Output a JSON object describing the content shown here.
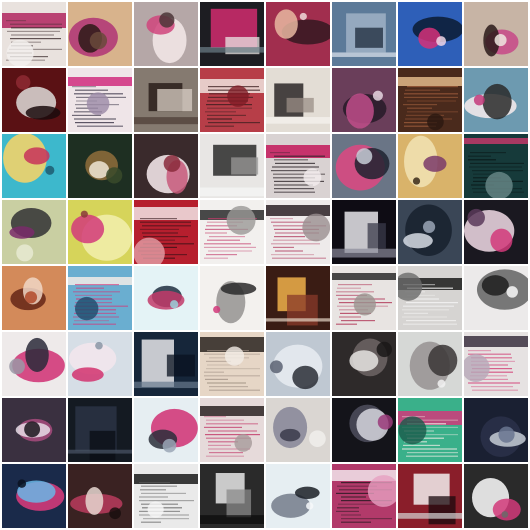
{
  "image": {
    "kind": "image-grid",
    "rows": 8,
    "cols": 8,
    "description_tags": [
      "generated-samples",
      "magazine-page-textures",
      "pink-magenta-accents"
    ]
  },
  "tiles": [
    {
      "bg": "#e9e2de",
      "a": "#b0265f",
      "b": "#3a2b2c",
      "c": "#f2f0ee",
      "style": "text"
    },
    {
      "bg": "#d8b38c",
      "a": "#2b1a16",
      "b": "#b23a77",
      "c": "#6a4a3b",
      "style": "blob"
    },
    {
      "bg": "#b5a7a7",
      "a": "#d0457c",
      "b": "#f1e6e6",
      "c": "#4b3537",
      "style": "blob"
    },
    {
      "bg": "#1d1d22",
      "a": "#d22b6e",
      "b": "#e9e6e4",
      "c": "#6c7f88",
      "style": "panel"
    },
    {
      "bg": "#a12e4e",
      "a": "#e7b7a1",
      "b": "#3a1a23",
      "c": "#f0d7d8",
      "style": "blob"
    },
    {
      "bg": "#5c7a99",
      "a": "#9fb2c6",
      "b": "#1d2b3b",
      "c": "#dfe6ee",
      "style": "panel"
    },
    {
      "bg": "#2e5fb8",
      "a": "#d53179",
      "b": "#0d1f3a",
      "c": "#f0d6e6",
      "style": "blob"
    },
    {
      "bg": "#c7b4a5",
      "a": "#2a1a19",
      "b": "#c64e8a",
      "c": "#efe7e0",
      "style": "blob"
    },
    {
      "bg": "#5a1114",
      "a": "#1b0c0d",
      "b": "#d6d0cd",
      "c": "#8e2a33",
      "style": "blob"
    },
    {
      "bg": "#efe5e8",
      "a": "#d02d7e",
      "b": "#2f2a3d",
      "c": "#9b8aa6",
      "style": "text"
    },
    {
      "bg": "#857a70",
      "a": "#2a1f1a",
      "b": "#d9cfc6",
      "c": "#4a3b33",
      "style": "panel"
    },
    {
      "bg": "#b73e48",
      "a": "#f0e4df",
      "b": "#3a1d1e",
      "c": "#7f1c25",
      "style": "text"
    },
    {
      "bg": "#e3ddd5",
      "a": "#2b2727",
      "b": "#9a8d85",
      "c": "#f6f3f0",
      "style": "panel"
    },
    {
      "bg": "#6a3e5a",
      "a": "#c04e8a",
      "b": "#2a1c2a",
      "c": "#e6d6e0",
      "style": "blob"
    },
    {
      "bg": "#4a2a1c",
      "a": "#e0b98a",
      "b": "#9a5a3a",
      "c": "#2a1810",
      "style": "text"
    },
    {
      "bg": "#6d9ab0",
      "a": "#2a2a2a",
      "b": "#f0e8ea",
      "c": "#c43a7b",
      "style": "blob"
    },
    {
      "bg": "#3db8cc",
      "a": "#c8325b",
      "b": "#f1d36a",
      "c": "#1d5a70",
      "style": "blob"
    },
    {
      "bg": "#1e2f22",
      "a": "#f0e6d6",
      "b": "#8a6a3a",
      "c": "#3a4a2a",
      "style": "blob"
    },
    {
      "bg": "#3a2a2c",
      "a": "#c85a7b",
      "b": "#efe2e6",
      "c": "#8a2a3b",
      "style": "blob"
    },
    {
      "bg": "#e8e6e4",
      "a": "#2a2a2a",
      "b": "#9a9898",
      "c": "#f6f6f6",
      "style": "panel"
    },
    {
      "bg": "#d9d2d2",
      "a": "#c2185b",
      "b": "#2a2226",
      "c": "#f3ecee",
      "style": "text"
    },
    {
      "bg": "#6a7586",
      "a": "#1e2330",
      "b": "#d84a82",
      "c": "#c7ccd6",
      "style": "blob"
    },
    {
      "bg": "#d9b36a",
      "a": "#7a3a6a",
      "b": "#f0e0b0",
      "c": "#3a2a1a",
      "style": "blob"
    },
    {
      "bg": "#163a3a",
      "a": "#c23a6a",
      "b": "#0a1818",
      "c": "#6a8a8a",
      "style": "text"
    },
    {
      "bg": "#c9cfa2",
      "a": "#7a2a6a",
      "b": "#3a3a3a",
      "c": "#e7ead2",
      "style": "blob"
    },
    {
      "bg": "#d6d45a",
      "a": "#d23a7a",
      "b": "#f1eda8",
      "c": "#8a3a3a",
      "style": "blob"
    },
    {
      "bg": "#b61f2e",
      "a": "#f2e6e6",
      "b": "#2a0f14",
      "c": "#e3a0a8",
      "style": "text"
    },
    {
      "bg": "#f2f0ee",
      "a": "#2a2a2a",
      "b": "#c23a6a",
      "c": "#9a9896",
      "style": "text"
    },
    {
      "bg": "#eeeaea",
      "a": "#2a2024",
      "b": "#b64a6a",
      "c": "#9a8e90",
      "style": "text"
    },
    {
      "bg": "#0e0c14",
      "a": "#e6e6ea",
      "b": "#3a3a4a",
      "c": "#8a8a9a",
      "style": "panel"
    },
    {
      "bg": "#3a4656",
      "a": "#d6dce4",
      "b": "#1a2230",
      "c": "#9aa6b6",
      "style": "blob"
    },
    {
      "bg": "#1a1820",
      "a": "#d23a7a",
      "b": "#e6d0dc",
      "c": "#5a3a5a",
      "style": "blob"
    },
    {
      "bg": "#d38a5a",
      "a": "#f0d6c6",
      "b": "#6a2a1a",
      "c": "#b24a2a",
      "style": "blob"
    },
    {
      "bg": "#6aaed0",
      "a": "#f2ece8",
      "b": "#d23a7a",
      "c": "#1d4a6a",
      "style": "text"
    },
    {
      "bg": "#e4f3f6",
      "a": "#c23a6a",
      "b": "#2a3a4a",
      "c": "#9ad0da",
      "style": "blob"
    },
    {
      "bg": "#f3f1ee",
      "a": "#2a2a2a",
      "b": "#9a9896",
      "c": "#d23a7a",
      "style": "blob"
    },
    {
      "bg": "#3a1c14",
      "a": "#f0b04a",
      "b": "#8a3a2a",
      "c": "#e6d6c6",
      "style": "panel"
    },
    {
      "bg": "#e8e4e2",
      "a": "#2a2a2a",
      "b": "#b23a5a",
      "c": "#9a9490",
      "style": "text"
    },
    {
      "bg": "#d6d4d2",
      "a": "#1a1a1a",
      "b": "#f6f6f6",
      "c": "#6a6a6a",
      "style": "text"
    },
    {
      "bg": "#eceaea",
      "a": "#1e1e1e",
      "b": "#6a6a6a",
      "c": "#f8f8f8",
      "style": "blob"
    },
    {
      "bg": "#eeeaea",
      "a": "#2a2a3a",
      "b": "#d23a7a",
      "c": "#9a98a6",
      "style": "blob"
    },
    {
      "bg": "#d6dee6",
      "a": "#d2336e",
      "b": "#f2e6ec",
      "c": "#8a96a6",
      "style": "blob"
    },
    {
      "bg": "#16263a",
      "a": "#e6e6ea",
      "b": "#0a1220",
      "c": "#6a7a8e",
      "style": "panel"
    },
    {
      "bg": "#e6d6c6",
      "a": "#2a2420",
      "b": "#a6968a",
      "c": "#f2ece6",
      "style": "text"
    },
    {
      "bg": "#bfc8d2",
      "a": "#2a2e36",
      "b": "#e6eaf0",
      "c": "#5a6272",
      "style": "blob"
    },
    {
      "bg": "#2e2a2a",
      "a": "#e6e4e2",
      "b": "#6a6262",
      "c": "#1a1818",
      "style": "blob"
    },
    {
      "bg": "#d6d8d6",
      "a": "#3a3636",
      "b": "#9a9696",
      "c": "#f2f2f2",
      "style": "blob"
    },
    {
      "bg": "#e6e2e2",
      "a": "#3a3040",
      "b": "#d2336e",
      "c": "#b6a8b8",
      "style": "text"
    },
    {
      "bg": "#3a3040",
      "a": "#e6dce6",
      "b": "#a24a7a",
      "c": "#1a141c",
      "style": "blob"
    },
    {
      "bg": "#141a22",
      "a": "#2a3444",
      "b": "#0a0e14",
      "c": "#4a5666",
      "style": "panel"
    },
    {
      "bg": "#e6eef2",
      "a": "#2a2e3a",
      "b": "#d23a7a",
      "c": "#9aa6b6",
      "style": "blob"
    },
    {
      "bg": "#e6dada",
      "a": "#2a2222",
      "b": "#c23a6a",
      "c": "#a69a9a",
      "style": "text"
    },
    {
      "bg": "#dad6d2",
      "a": "#3a3a4a",
      "b": "#8a8a9a",
      "c": "#f0eeec",
      "style": "blob"
    },
    {
      "bg": "#14141a",
      "a": "#d6d6de",
      "b": "#4a4a5a",
      "c": "#9a3a7a",
      "style": "blob"
    },
    {
      "bg": "#3ab08a",
      "a": "#d23a7a",
      "b": "#f2ece6",
      "c": "#1a5a4a",
      "style": "text"
    },
    {
      "bg": "#1a2032",
      "a": "#c6ccd6",
      "b": "#2a3048",
      "c": "#6a7690",
      "style": "blob"
    },
    {
      "bg": "#1a2a4a",
      "a": "#6ab6e6",
      "b": "#d23a7a",
      "c": "#0a1220",
      "style": "blob"
    },
    {
      "bg": "#3a2222",
      "a": "#e6d6d0",
      "b": "#b23a5a",
      "c": "#1a0e0e",
      "style": "blob"
    },
    {
      "bg": "#eaeaea",
      "a": "#1a1a1a",
      "b": "#6a6a6a",
      "c": "#f6f6f6",
      "style": "text"
    },
    {
      "bg": "#2a2a2a",
      "a": "#e6e6e6",
      "b": "#8a8a8a",
      "c": "#0a0a0a",
      "style": "panel"
    },
    {
      "bg": "#e6eef2",
      "a": "#1a1e26",
      "b": "#7a8290",
      "c": "#f6f8fa",
      "style": "blob"
    },
    {
      "bg": "#b23a6a",
      "a": "#f2e6ec",
      "b": "#2a1a22",
      "c": "#e6a0c0",
      "style": "text"
    },
    {
      "bg": "#8a1e2a",
      "a": "#f2eeee",
      "b": "#1a0a0e",
      "c": "#d6d6d6",
      "style": "panel"
    },
    {
      "bg": "#2a2a2a",
      "a": "#d23a7a",
      "b": "#f2f2f2",
      "c": "#6a6a6a",
      "style": "blob"
    }
  ]
}
